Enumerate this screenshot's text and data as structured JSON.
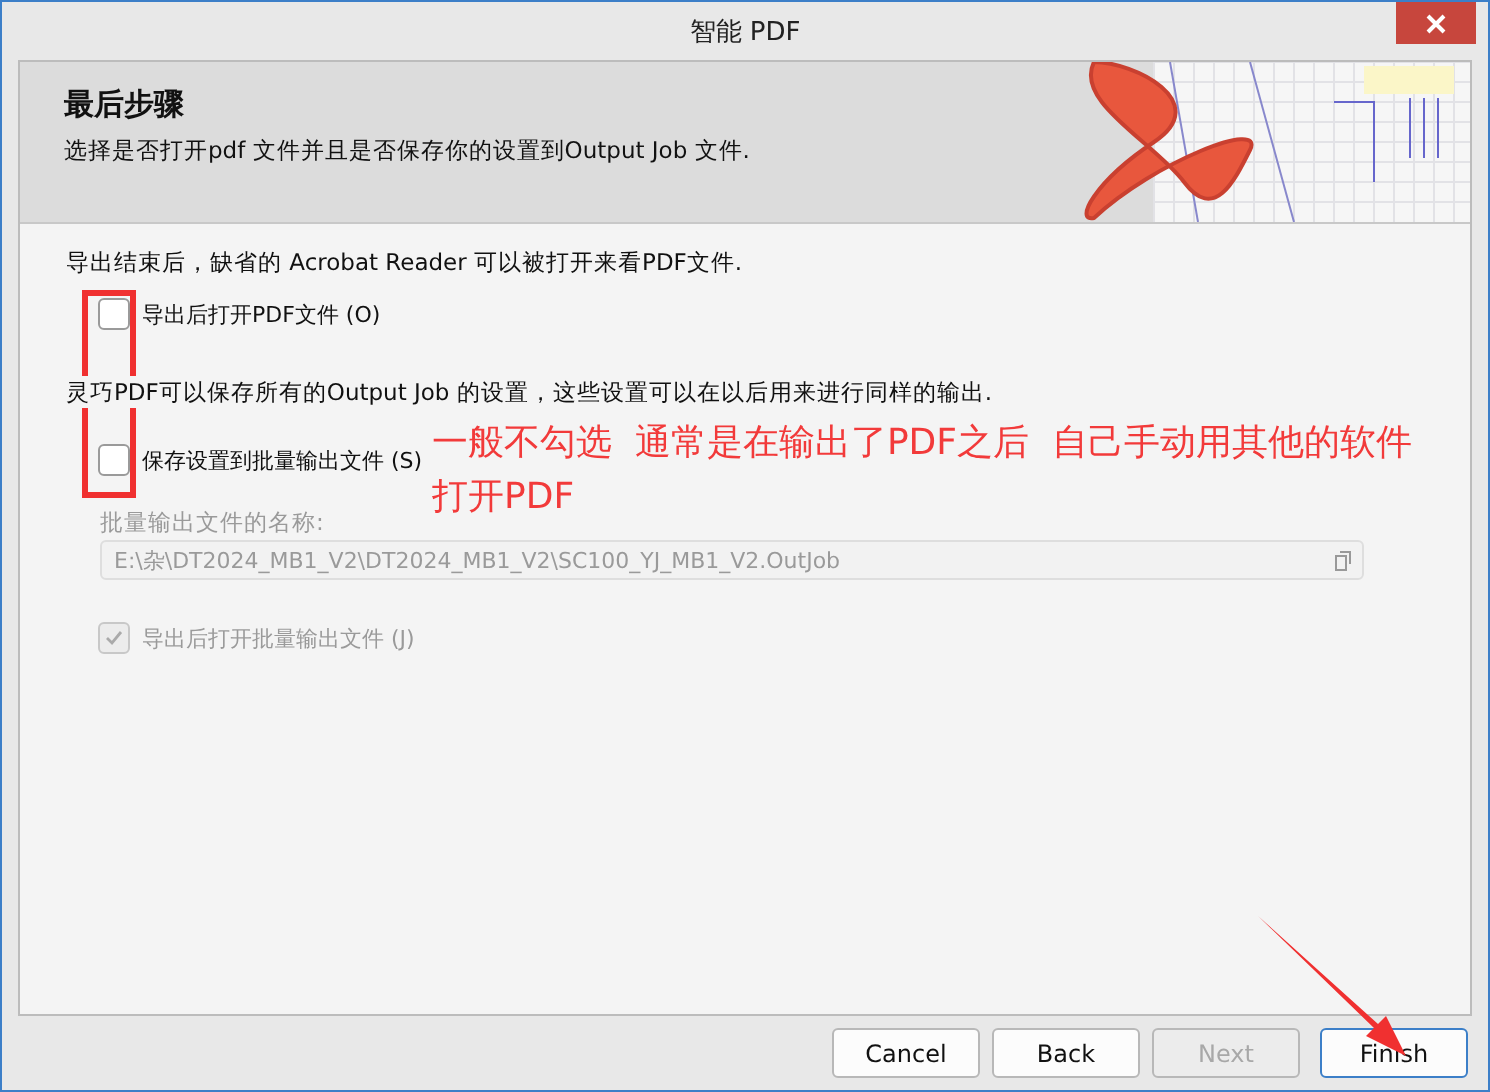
{
  "window": {
    "title": "智能 PDF"
  },
  "header": {
    "title": "最后步骤",
    "subtitle": "选择是否打开pdf 文件并且是否保存你的设置到Output Job 文件."
  },
  "sections": [
    {
      "description": "导出结束后，缺省的 Acrobat Reader 可以被打开来看PDF文件.",
      "checkbox": {
        "label": "导出后打开PDF文件 (O)",
        "checked": false,
        "disabled": false
      }
    },
    {
      "description": "灵巧PDF可以保存所有的Output Job 的设置，这些设置可以在以后用来进行同样的输出.",
      "checkbox": {
        "label": "保存设置到批量输出文件 (S)",
        "checked": false,
        "disabled": false
      }
    }
  ],
  "batch": {
    "label": "批量输出文件的名称:",
    "value": "E:\\杂\\DT2024_MB1_V2\\DT2024_MB1_V2\\SC100_YJ_MB1_V2.OutJob",
    "disabled": true,
    "checkbox": {
      "label": "导出后打开批量输出文件 (J)",
      "checked": true,
      "disabled": true
    }
  },
  "annotation": {
    "text": "一般不勾选  通常是在输出了PDF之后  自己手动用其他的软件打开PDF"
  },
  "buttons": [
    {
      "label": "Cancel",
      "disabled": false,
      "selected": false
    },
    {
      "label": "Back",
      "disabled": false,
      "selected": false
    },
    {
      "label": "Next",
      "disabled": true,
      "selected": false
    },
    {
      "label": "Finish",
      "disabled": false,
      "selected": true
    }
  ]
}
